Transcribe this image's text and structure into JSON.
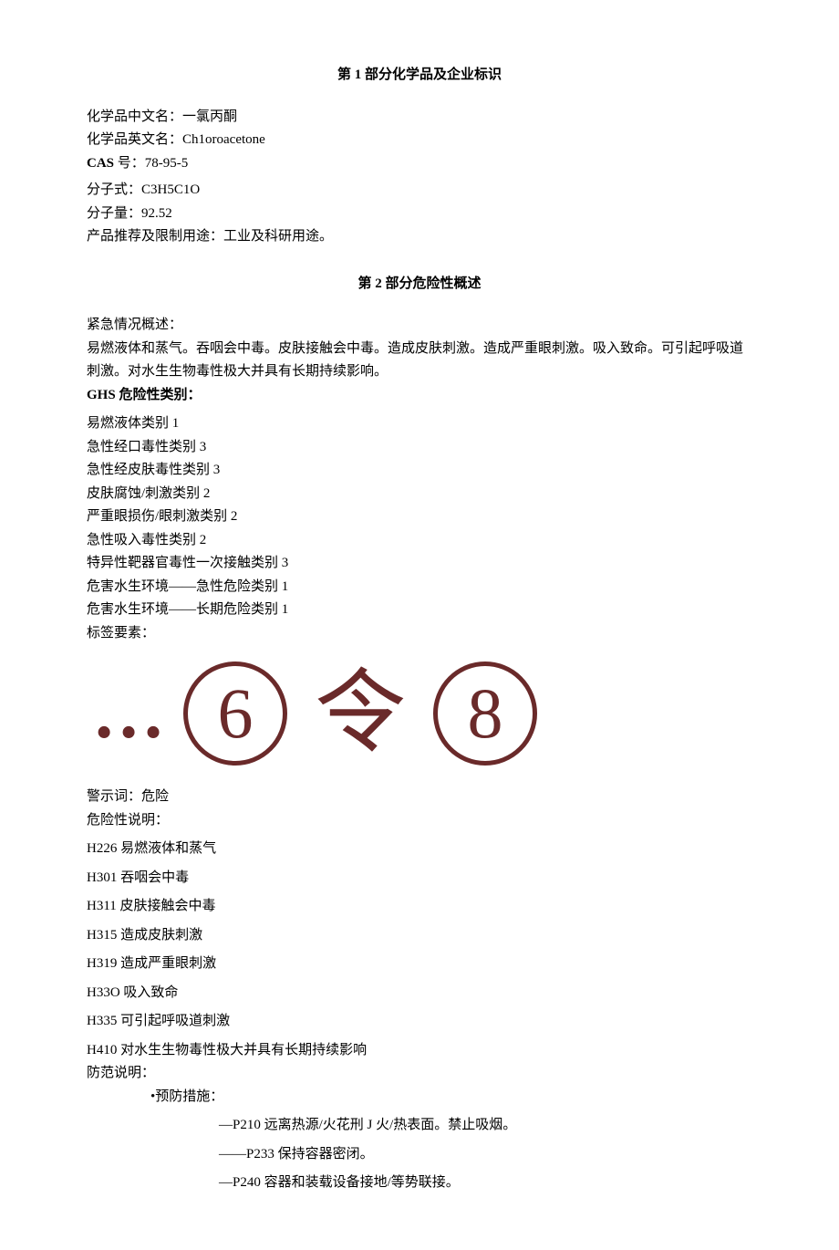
{
  "section1": {
    "title_prefix": "第",
    "title_num": "1",
    "title_suffix": "部分化学品及企业标识",
    "fields": {
      "name_cn_label": "化学品中文名：",
      "name_cn_value": "一氯丙酮",
      "name_en_label": "化学品英文名：",
      "name_en_value": "Ch1oroacetone",
      "cas_label": "CAS",
      "cas_suffix": "号：",
      "cas_value": "78-95-5",
      "formula_label": "分子式：",
      "formula_value": "C3H5C1O",
      "weight_label": "分子量：",
      "weight_value": "92.52",
      "usage_label": "产品推荐及限制用途：",
      "usage_value": "工业及科研用途。"
    }
  },
  "section2": {
    "title_prefix": "第",
    "title_num": "2",
    "title_suffix": "部分危险性概述",
    "emergency_label": "紧急情况概述：",
    "emergency_text": "易燃液体和蒸气。吞咽会中毒。皮肤接触会中毒。造成皮肤刺激。造成严重眼刺激。吸入致命。可引起呼吸道刺激。对水生生物毒性极大并具有长期持续影响。",
    "ghs_label_prefix": "GHS",
    "ghs_label_suffix": "危险性类别：",
    "ghs_items": [
      "易燃液体类别 1",
      "急性经口毒性类别 3",
      "急性经皮肤毒性类别 3",
      "皮肤腐蚀/刺激类别 2",
      "严重眼损伤/眼刺激类别 2",
      "急性吸入毒性类别 2",
      "特异性靶器官毒性一次接触类别 3",
      "危害水生环境——急性危险类别 1",
      "危害水生环境——长期危险类别 1"
    ],
    "label_elements": "标签要素：",
    "pictogram_dots": "…",
    "pictogram_6": "6",
    "pictogram_ling": "令",
    "pictogram_8": "8",
    "signal_label": "警示词：",
    "signal_value": "危险",
    "hazard_label": "危险性说明：",
    "hazards": [
      "H226 易燃液体和蒸气",
      "H301 吞咽会中毒",
      "H311 皮肤接触会中毒",
      "H315 造成皮肤刺激",
      "H319 造成严重眼刺激",
      "H33O 吸入致命",
      "H335 可引起呼吸道刺激",
      "H410 对水生生物毒性极大并具有长期持续影响"
    ],
    "precaution_label": "防范说明：",
    "prevention_label": "•预防措施：",
    "prevention_items": [
      "—P210 远离热源/火花刑 J 火/热表面。禁止吸烟。",
      "——P233 保持容器密闭。",
      "—P240 容器和装载设备接地/等势联接。"
    ]
  }
}
